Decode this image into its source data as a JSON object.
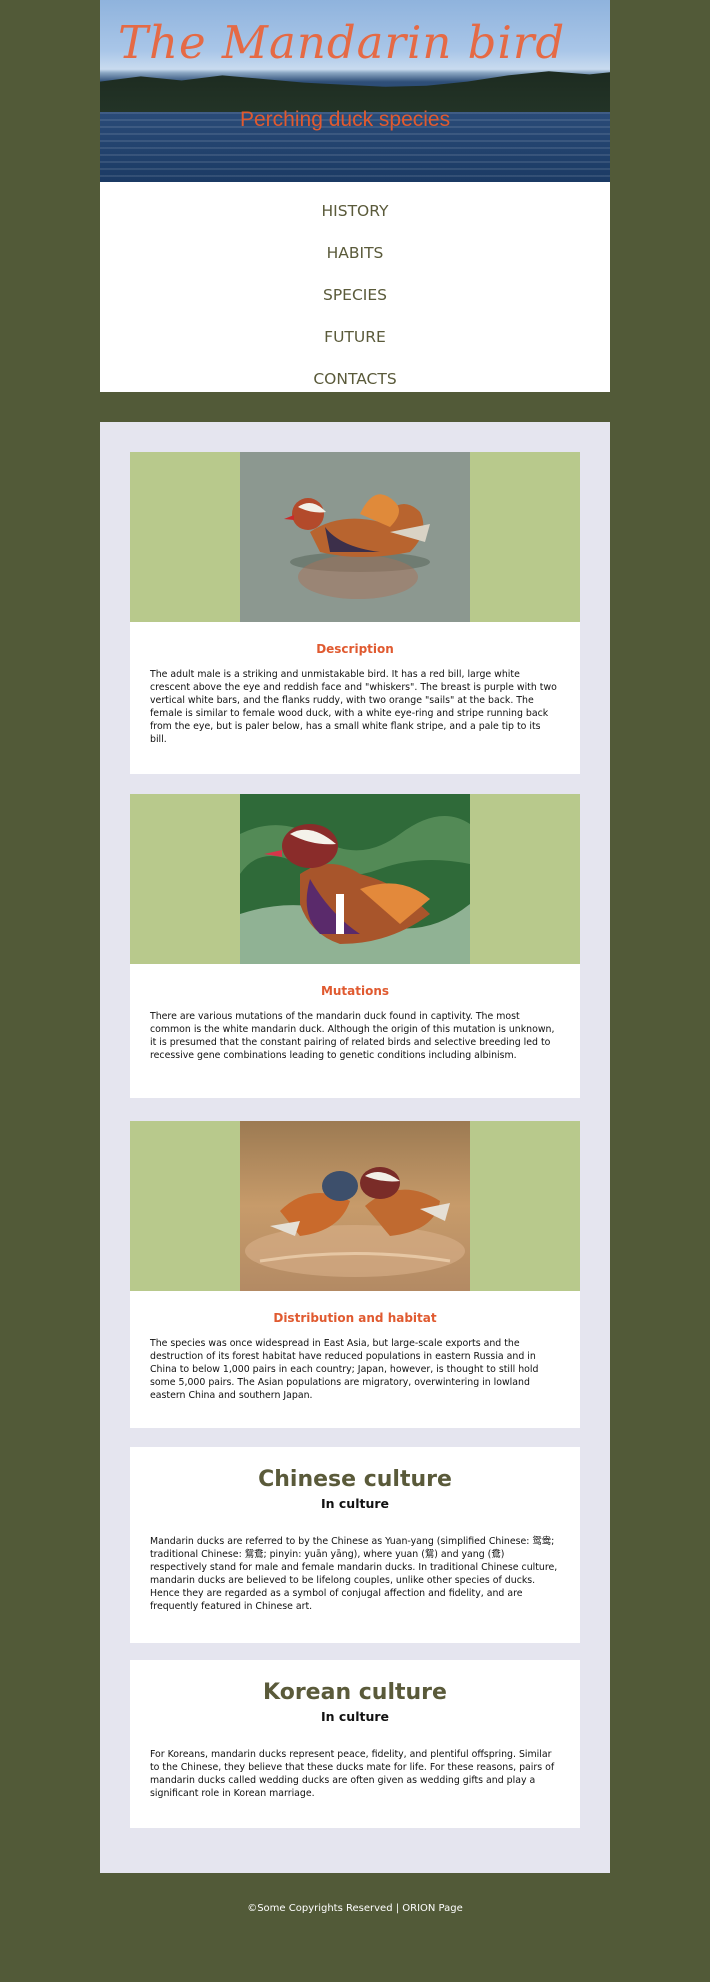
{
  "header": {
    "title": "The Mandarin bird",
    "subtitle": "Perching duck species"
  },
  "nav": {
    "items": [
      "HISTORY",
      "HABITS",
      "SPECIES",
      "FUTURE",
      "CONTACTS"
    ]
  },
  "sections": {
    "description": {
      "heading": "Description",
      "text": "The adult male is a striking and unmistakable bird. It has a red bill, large white crescent above the eye and reddish face and \"whiskers\". The breast is purple with two vertical white bars, and the flanks ruddy, with two orange \"sails\" at the back. The female is similar to female wood duck, with a white eye-ring and stripe running back from the eye, but is paler below, has a small white flank stripe, and a pale tip to its bill."
    },
    "mutations": {
      "heading": "Mutations",
      "text": "There are various mutations of the mandarin duck found in captivity. The most common is the white mandarin duck. Although the origin of this mutation is unknown, it is presumed that the constant pairing of related birds and selective breeding led to recessive gene combinations leading to genetic conditions including albinism."
    },
    "distribution": {
      "heading": "Distribution and habitat",
      "text": "The species was once widespread in East Asia, but large-scale exports and the destruction of its forest habitat have reduced populations in eastern Russia and in China to below 1,000 pairs in each country; Japan, however, is thought to still hold some 5,000 pairs. The Asian populations are migratory, overwintering in lowland eastern China and southern Japan."
    },
    "chinese": {
      "heading": "Chinese culture",
      "subheading": "In culture",
      "text": "Mandarin ducks are referred to by the Chinese as Yuan-yang (simplified Chinese: 鸳鸯; traditional Chinese: 鴛鴦; pinyin: yuān yāng), where yuan (鴛) and yang (鴦) respectively stand for male and female mandarin ducks. In traditional Chinese culture, mandarin ducks are believed to be lifelong couples, unlike other species of ducks. Hence they are regarded as a symbol of conjugal affection and fidelity, and are frequently featured in Chinese art."
    },
    "korean": {
      "heading": "Korean culture",
      "subheading": "In culture",
      "text": "For Koreans, mandarin ducks represent peace, fidelity, and plentiful offspring. Similar to the Chinese, they believe that these ducks mate for life. For these reasons, pairs of mandarin ducks called wedding ducks are often given as wedding gifts and play a significant role in Korean marriage."
    }
  },
  "footer": {
    "text": "©Some Copyrights Reserved | ORION Page"
  },
  "colors": {
    "page_bg": "#525a38",
    "content_bg": "#e5e5ef",
    "photo_band": "#b8c98c",
    "accent": "#e05a30",
    "nav_text": "#5a5a3a"
  }
}
